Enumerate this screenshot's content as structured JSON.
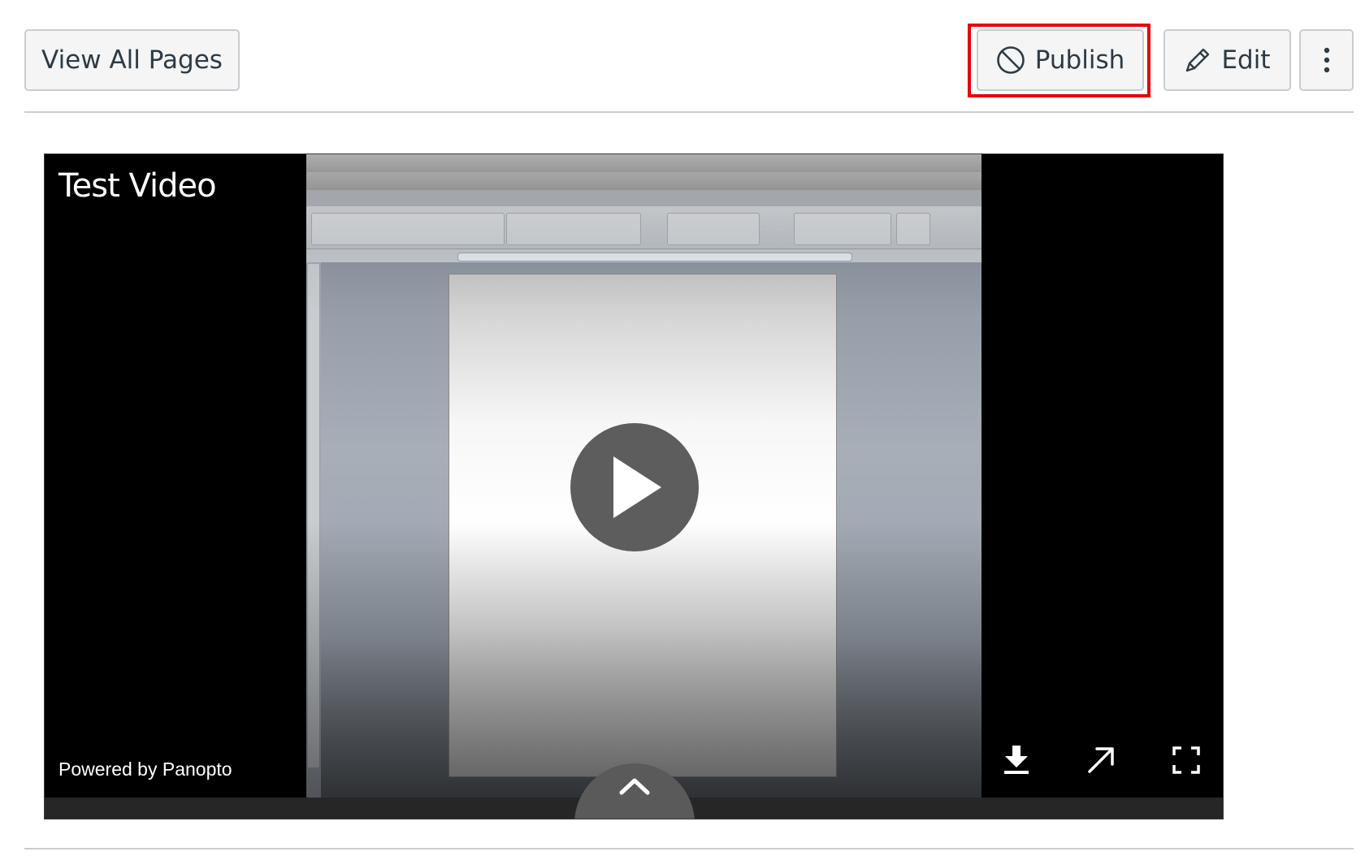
{
  "toolbar": {
    "view_all_pages_label": "View All Pages",
    "publish_label": "Publish",
    "edit_label": "Edit",
    "publish_icon": "unpublished-circle-slash-icon",
    "edit_icon": "pencil-icon",
    "more_icon": "kebab-vertical-dots-icon",
    "highlight_color": "#e8000b"
  },
  "video": {
    "title": "Test Video",
    "powered_by": "Powered by Panopto",
    "controls": {
      "play_icon": "play-icon",
      "expand_icon": "chevron-up-icon",
      "download_icon": "download-icon",
      "popout_icon": "arrow-up-right-icon",
      "fullscreen_icon": "fullscreen-icon"
    }
  }
}
